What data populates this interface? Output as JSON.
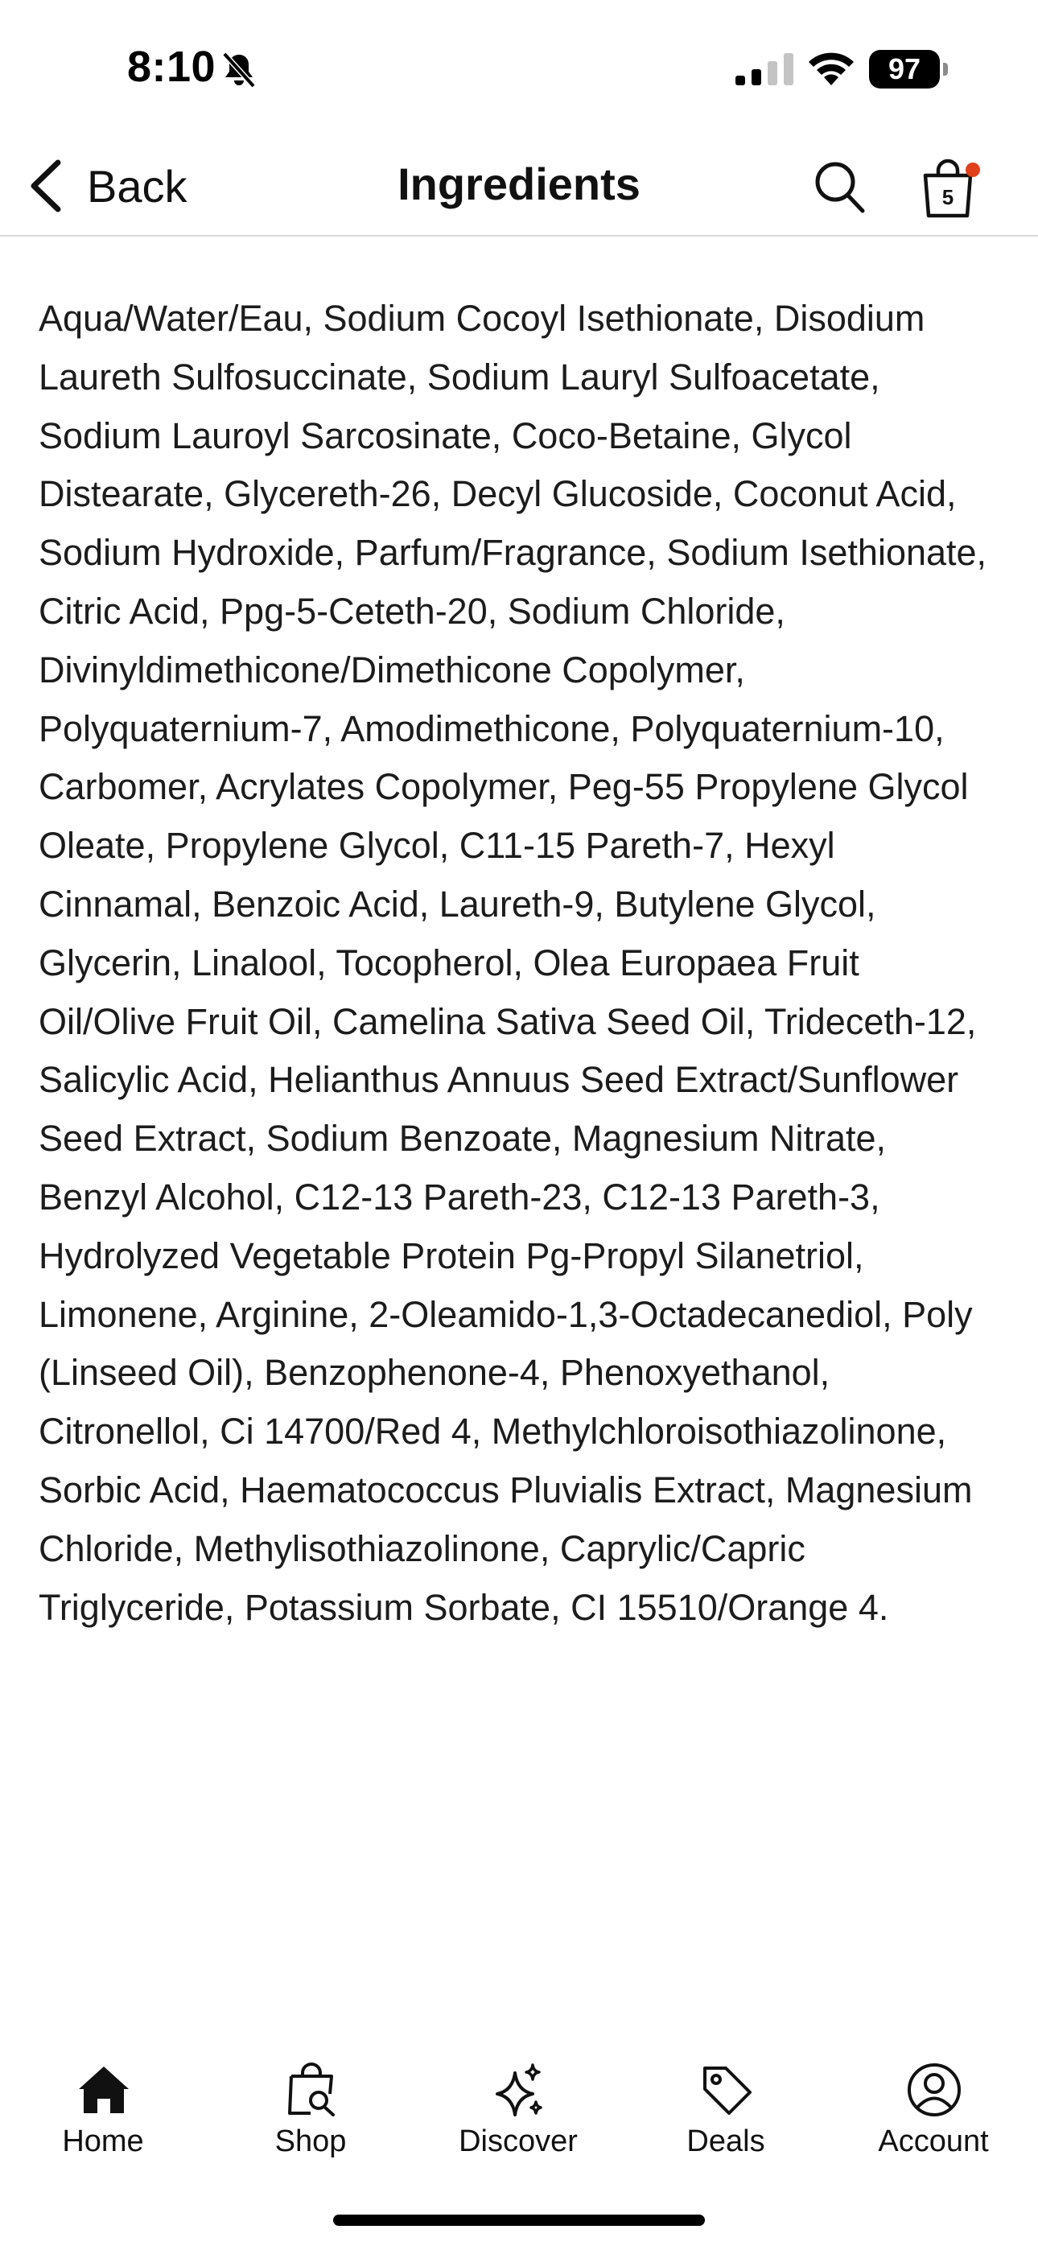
{
  "status_bar": {
    "time": "8:10",
    "battery": "97",
    "icons": [
      "bell-slash-icon",
      "cellular-signal-icon",
      "wifi-icon",
      "battery-icon"
    ]
  },
  "nav": {
    "back_label": "Back",
    "title": "Ingredients",
    "bag_count": "5",
    "accent_color": "#e2401c"
  },
  "ingredients": {
    "text": "Aqua/Water/Eau, Sodium Cocoyl Isethionate, Disodium Laureth Sulfosuccinate, Sodium Lauryl Sulfoacetate, Sodium Lauroyl Sarcosinate, Coco-Betaine, Glycol Distearate, Glycereth-26, Decyl Glucoside, Coconut Acid, Sodium Hydroxide, Parfum/Fragrance, Sodium Isethionate, Citric Acid, Ppg-5-Ceteth-20, Sodium Chloride, Divinyldimethicone/Dimethicone Copolymer, Polyquaternium-7, Amodimethicone, Polyquaternium-10, Carbomer, Acrylates Copolymer, Peg-55 Propylene Glycol Oleate, Propylene Glycol, C11-15 Pareth-7, Hexyl Cinnamal, Benzoic Acid, Laureth-9, Butylene Glycol, Glycerin, Linalool, Tocopherol, Olea Europaea Fruit Oil/Olive Fruit Oil, Camelina Sativa Seed Oil, Trideceth-12, Salicylic Acid, Helianthus Annuus Seed Extract/Sunflower Seed Extract, Sodium Benzoate, Magnesium Nitrate, Benzyl Alcohol, C12-13 Pareth-23, C12-13 Pareth-3, Hydrolyzed Vegetable Protein Pg-Propyl Silanetriol, Limonene, Arginine, 2-Oleamido-1,3-Octadecanediol, Poly (Linseed Oil), Benzophenone-4, Phenoxyethanol, Citronellol, Ci 14700/Red 4, Methylchloroisothiazolinone, Sorbic Acid, Haematococcus Pluvialis Extract, Magnesium Chloride, Methylisothiazolinone, Caprylic/Capric Triglyceride, Potassium Sorbate, CI 15510/Orange 4."
  },
  "tabbar": {
    "items": [
      {
        "label": "Home",
        "icon": "home-icon"
      },
      {
        "label": "Shop",
        "icon": "shop-search-icon"
      },
      {
        "label": "Discover",
        "icon": "sparkles-icon"
      },
      {
        "label": "Deals",
        "icon": "tag-icon"
      },
      {
        "label": "Account",
        "icon": "account-icon"
      }
    ]
  }
}
